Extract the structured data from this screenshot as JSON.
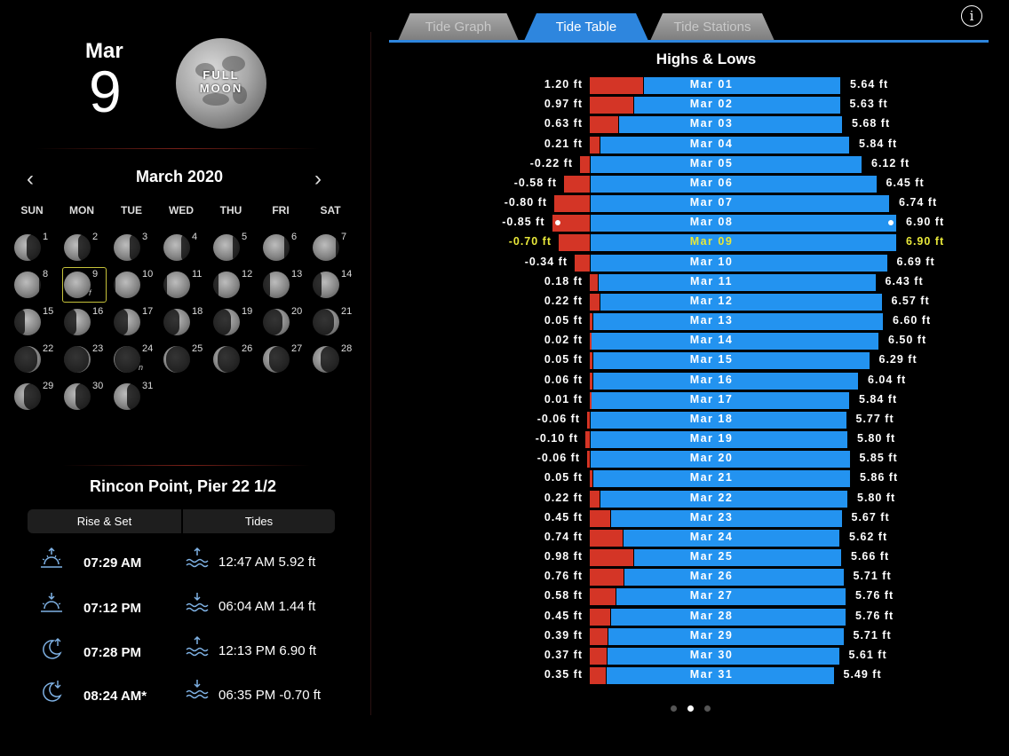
{
  "date": {
    "month": "Mar",
    "day": "9"
  },
  "moon_phase": {
    "label_line1": "FULL",
    "label_line2": "MOON"
  },
  "calendar": {
    "title": "March 2020",
    "prev_icon": "chevron-left-icon",
    "next_icon": "chevron-right-icon",
    "weekdays": [
      "SUN",
      "MON",
      "TUE",
      "WED",
      "THU",
      "FRI",
      "SAT"
    ],
    "days": [
      "1",
      "2",
      "3",
      "4",
      "5",
      "6",
      "7",
      "8",
      "9",
      "10",
      "11",
      "12",
      "13",
      "14",
      "15",
      "16",
      "17",
      "18",
      "19",
      "20",
      "21",
      "22",
      "23",
      "24",
      "25",
      "26",
      "27",
      "28",
      "29",
      "30",
      "31"
    ],
    "selected_day": "9",
    "markers": {
      "9": "f",
      "24": "n"
    }
  },
  "location": "Rincon Point, Pier 22 1/2",
  "tabs_left": {
    "rise_set": "Rise & Set",
    "tides": "Tides"
  },
  "rise_set": [
    {
      "icon": "sunrise-icon",
      "time": "07:29 AM"
    },
    {
      "icon": "sunset-icon",
      "time": "07:12 PM"
    },
    {
      "icon": "moonrise-icon",
      "time": "07:28 PM"
    },
    {
      "icon": "moonset-icon",
      "time": "08:24 AM*"
    }
  ],
  "tides": [
    {
      "icon": "high-tide-icon",
      "text": "12:47 AM  5.92 ft"
    },
    {
      "icon": "low-tide-icon",
      "text": "06:04 AM  1.44 ft"
    },
    {
      "icon": "high-tide-icon",
      "text": "12:13 PM  6.90 ft"
    },
    {
      "icon": "low-tide-icon",
      "text": "06:35 PM  -0.70 ft"
    }
  ],
  "top_tabs": {
    "graph": "Tide Graph",
    "table": "Tide Table",
    "stations": "Tide Stations"
  },
  "info_label": "i",
  "table_title": "Highs & Lows",
  "colors": {
    "low_bar": "#d43526",
    "high_bar": "#2393f0",
    "today": "#e8e83a",
    "accent": "#2e86de"
  },
  "tide_table": [
    {
      "date": "Mar 01",
      "low": "1.20 ft",
      "high": "5.64 ft",
      "low_v": 1.2,
      "high_v": 5.64
    },
    {
      "date": "Mar 02",
      "low": "0.97 ft",
      "high": "5.63 ft",
      "low_v": 0.97,
      "high_v": 5.63
    },
    {
      "date": "Mar 03",
      "low": "0.63 ft",
      "high": "5.68 ft",
      "low_v": 0.63,
      "high_v": 5.68
    },
    {
      "date": "Mar 04",
      "low": "0.21 ft",
      "high": "5.84 ft",
      "low_v": 0.21,
      "high_v": 5.84
    },
    {
      "date": "Mar 05",
      "low": "-0.22 ft",
      "high": "6.12 ft",
      "low_v": -0.22,
      "high_v": 6.12
    },
    {
      "date": "Mar 06",
      "low": "-0.58 ft",
      "high": "6.45 ft",
      "low_v": -0.58,
      "high_v": 6.45
    },
    {
      "date": "Mar 07",
      "low": "-0.80 ft",
      "high": "6.74 ft",
      "low_v": -0.8,
      "high_v": 6.74
    },
    {
      "date": "Mar 08",
      "low": "-0.85 ft",
      "high": "6.90 ft",
      "low_v": -0.85,
      "high_v": 6.9,
      "extreme": true
    },
    {
      "date": "Mar 09",
      "low": "-0.70 ft",
      "high": "6.90 ft",
      "low_v": -0.7,
      "high_v": 6.9,
      "today": true
    },
    {
      "date": "Mar 10",
      "low": "-0.34 ft",
      "high": "6.69 ft",
      "low_v": -0.34,
      "high_v": 6.69
    },
    {
      "date": "Mar 11",
      "low": "0.18 ft",
      "high": "6.43 ft",
      "low_v": 0.18,
      "high_v": 6.43
    },
    {
      "date": "Mar 12",
      "low": "0.22 ft",
      "high": "6.57 ft",
      "low_v": 0.22,
      "high_v": 6.57
    },
    {
      "date": "Mar 13",
      "low": "0.05 ft",
      "high": "6.60 ft",
      "low_v": 0.05,
      "high_v": 6.6
    },
    {
      "date": "Mar 14",
      "low": "0.02 ft",
      "high": "6.50 ft",
      "low_v": 0.02,
      "high_v": 6.5
    },
    {
      "date": "Mar 15",
      "low": "0.05 ft",
      "high": "6.29 ft",
      "low_v": 0.05,
      "high_v": 6.29
    },
    {
      "date": "Mar 16",
      "low": "0.06 ft",
      "high": "6.04 ft",
      "low_v": 0.06,
      "high_v": 6.04
    },
    {
      "date": "Mar 17",
      "low": "0.01 ft",
      "high": "5.84 ft",
      "low_v": 0.01,
      "high_v": 5.84
    },
    {
      "date": "Mar 18",
      "low": "-0.06 ft",
      "high": "5.77 ft",
      "low_v": -0.06,
      "high_v": 5.77
    },
    {
      "date": "Mar 19",
      "low": "-0.10 ft",
      "high": "5.80 ft",
      "low_v": -0.1,
      "high_v": 5.8
    },
    {
      "date": "Mar 20",
      "low": "-0.06 ft",
      "high": "5.85 ft",
      "low_v": -0.06,
      "high_v": 5.85
    },
    {
      "date": "Mar 21",
      "low": "0.05 ft",
      "high": "5.86 ft",
      "low_v": 0.05,
      "high_v": 5.86
    },
    {
      "date": "Mar 22",
      "low": "0.22 ft",
      "high": "5.80 ft",
      "low_v": 0.22,
      "high_v": 5.8
    },
    {
      "date": "Mar 23",
      "low": "0.45 ft",
      "high": "5.67 ft",
      "low_v": 0.45,
      "high_v": 5.67
    },
    {
      "date": "Mar 24",
      "low": "0.74 ft",
      "high": "5.62 ft",
      "low_v": 0.74,
      "high_v": 5.62
    },
    {
      "date": "Mar 25",
      "low": "0.98 ft",
      "high": "5.66 ft",
      "low_v": 0.98,
      "high_v": 5.66
    },
    {
      "date": "Mar 26",
      "low": "0.76 ft",
      "high": "5.71 ft",
      "low_v": 0.76,
      "high_v": 5.71
    },
    {
      "date": "Mar 27",
      "low": "0.58 ft",
      "high": "5.76 ft",
      "low_v": 0.58,
      "high_v": 5.76
    },
    {
      "date": "Mar 28",
      "low": "0.45 ft",
      "high": "5.76 ft",
      "low_v": 0.45,
      "high_v": 5.76
    },
    {
      "date": "Mar 29",
      "low": "0.39 ft",
      "high": "5.71 ft",
      "low_v": 0.39,
      "high_v": 5.71
    },
    {
      "date": "Mar 30",
      "low": "0.37 ft",
      "high": "5.61 ft",
      "low_v": 0.37,
      "high_v": 5.61
    },
    {
      "date": "Mar 31",
      "low": "0.35 ft",
      "high": "5.49 ft",
      "low_v": 0.35,
      "high_v": 5.49
    }
  ],
  "pager": {
    "count": 3,
    "active": 1
  }
}
